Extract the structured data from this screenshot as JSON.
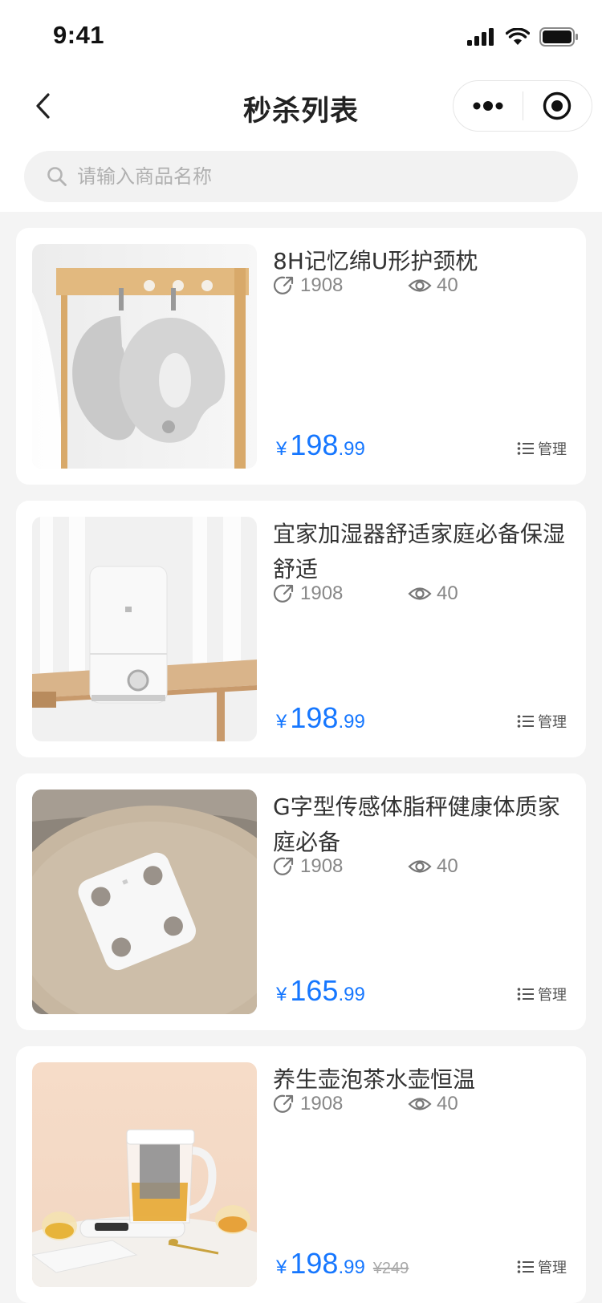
{
  "status_bar": {
    "time": "9:41"
  },
  "nav": {
    "title": "秒杀列表"
  },
  "search": {
    "placeholder": "请输入商品名称",
    "value": ""
  },
  "products": [
    {
      "title": "8H记忆绵U形护颈枕",
      "shares": "1908",
      "views": "40",
      "currency": "¥",
      "price_int": "198",
      "price_dec": ".99",
      "original_price": "",
      "manage_label": "管理",
      "image": "neck-pillow"
    },
    {
      "title": "宜家加湿器舒适家庭必备保湿舒适",
      "shares": "1908",
      "views": "40",
      "currency": "¥",
      "price_int": "198",
      "price_dec": ".99",
      "original_price": "",
      "manage_label": "管理",
      "image": "humidifier"
    },
    {
      "title": "G字型传感体脂秤健康体质家庭必备",
      "shares": "1908",
      "views": "40",
      "currency": "¥",
      "price_int": "165",
      "price_dec": ".99",
      "original_price": "",
      "manage_label": "管理",
      "image": "body-fat-scale"
    },
    {
      "title": "养生壶泡茶水壶恒温",
      "shares": "1908",
      "views": "40",
      "currency": "¥",
      "price_int": "198",
      "price_dec": ".99",
      "original_price": "¥249",
      "manage_label": "管理",
      "image": "tea-kettle"
    }
  ],
  "colors": {
    "price": "#1677ff",
    "background": "#f4f4f4",
    "card": "#ffffff"
  }
}
